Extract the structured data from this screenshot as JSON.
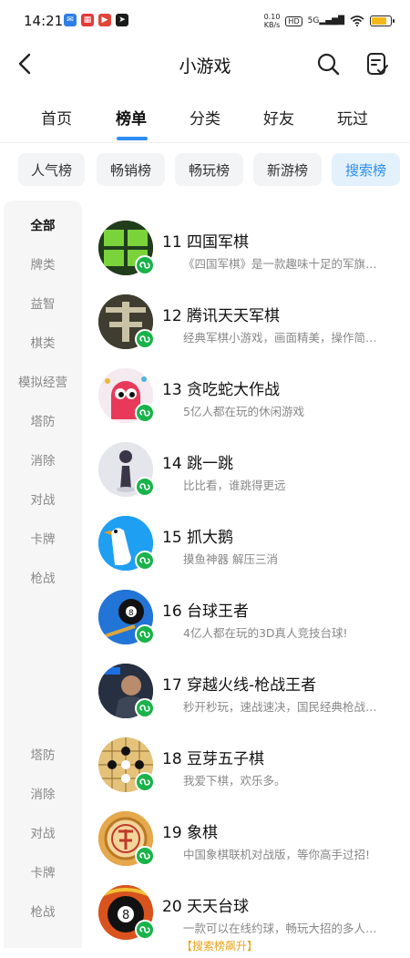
{
  "status": {
    "time": "14:21",
    "net_speed": "0.10",
    "net_unit": "KB/s",
    "hd": "HD",
    "signal": "5G",
    "battery_level": 0.85,
    "app_icons": [
      "mail-app-icon",
      "news-app-icon",
      "video-app-icon",
      "send-app-icon"
    ]
  },
  "header": {
    "title": "小游戏"
  },
  "main_tabs": [
    "首页",
    "榜单",
    "分类",
    "好友",
    "玩过"
  ],
  "active_tab": "榜单",
  "chips": [
    "人气榜",
    "畅销榜",
    "畅玩榜",
    "新游榜",
    "搜索榜"
  ],
  "active_chip": "搜索榜",
  "sidebar": {
    "top_items": [
      "全部",
      "牌类",
      "益智",
      "棋类",
      "模拟经营",
      "塔防",
      "消除",
      "对战",
      "卡牌",
      "枪战"
    ],
    "bottom_items": [
      "塔防",
      "消除",
      "对战",
      "卡牌",
      "枪战"
    ],
    "active": "全部"
  },
  "games": [
    {
      "title": "11 四国军棋",
      "desc": "《四国军棋》是一款趣味十足的军旗…",
      "icon": "four-nations-chess-icon"
    },
    {
      "title": "12 腾讯天天军棋",
      "desc": "经典军棋小游戏，画面精美，操作简…",
      "icon": "tencent-military-chess-icon"
    },
    {
      "title": "13 贪吃蛇大作战",
      "desc": "5亿人都在玩的休闲游戏",
      "icon": "snake-game-icon"
    },
    {
      "title": "14 跳一跳",
      "desc": "比比看，谁跳得更远",
      "icon": "jump-game-icon"
    },
    {
      "title": "15 抓大鹅",
      "desc": "摸鱼神器  解压三消",
      "icon": "goose-game-icon"
    },
    {
      "title": "16 台球王者",
      "desc": "4亿人都在玩的3D真人竞技台球!",
      "icon": "billiards-king-icon"
    },
    {
      "title": "17 穿越火线-枪战王者",
      "desc": "秒开秒玩，速战速决，国民经典枪战…",
      "icon": "crossfire-icon"
    },
    {
      "title": "18 豆芽五子棋",
      "desc": "我爱下棋，欢乐多。",
      "icon": "gomoku-icon"
    },
    {
      "title": "19 象棋",
      "desc": "中国象棋联机对战版，等你高手过招!",
      "icon": "chinese-chess-icon"
    },
    {
      "title": "20 天天台球",
      "desc": "一款可以在线约球，畅玩大招的多人…",
      "icon": "daily-billiards-icon",
      "tag": "【搜索榜飙升】"
    }
  ],
  "colors": {
    "accent": "#2c8ef0",
    "chip_active_bg": "#e3f1fd",
    "mini_program_badge": "#19b34a",
    "tag": "#e8a31b"
  }
}
